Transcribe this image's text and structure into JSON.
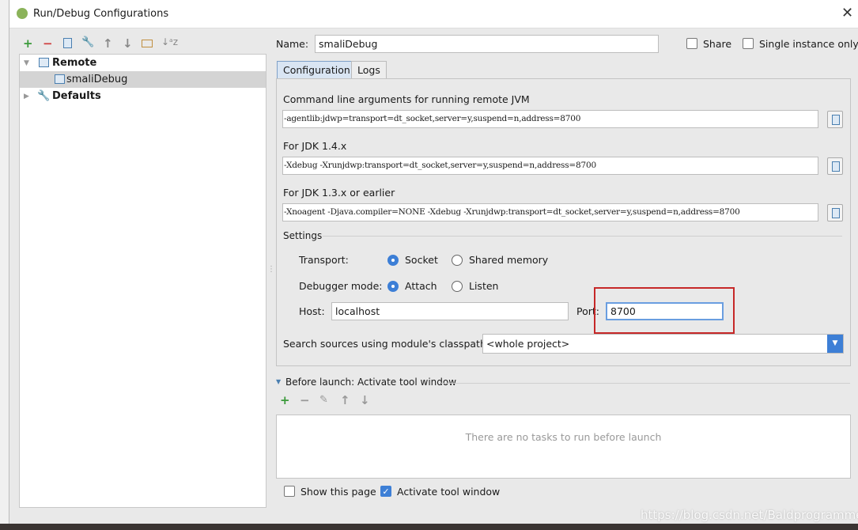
{
  "window": {
    "title": "Run/Debug Configurations",
    "close": "✕"
  },
  "toolbar": {
    "add": "+",
    "remove": "−",
    "copy": "copy-icon",
    "edit_defaults": "wrench-icon",
    "move_up": "↑",
    "move_down": "↓",
    "folder": "folder-icon",
    "sort": "↓ᵃz"
  },
  "tree": [
    {
      "label": "Remote",
      "expanded": true
    },
    {
      "label": "smaliDebug",
      "selected": true
    },
    {
      "label": "Defaults",
      "expanded": false
    }
  ],
  "name": {
    "label": "Name:",
    "value": "smaliDebug"
  },
  "share": {
    "label": "Share",
    "checked": false
  },
  "single_instance": {
    "label": "Single instance only",
    "checked": false
  },
  "tabs": [
    {
      "label": "Configuration",
      "active": true
    },
    {
      "label": "Logs",
      "active": false
    }
  ],
  "config": {
    "cmd_label": "Command line arguments for running remote JVM",
    "cmd_value": "-agentlib:jdwp=transport=dt_socket,server=y,suspend=n,address=8700",
    "jdk14_label": "For JDK 1.4.x",
    "jdk14_value": "-Xdebug -Xrunjdwp:transport=dt_socket,server=y,suspend=n,address=8700",
    "jdk13_label": "For JDK 1.3.x or earlier",
    "jdk13_value": "-Xnoagent -Djava.compiler=NONE -Xdebug -Xrunjdwp:transport=dt_socket,server=y,suspend=n,address=8700",
    "settings_label": "Settings",
    "transport_label": "Transport:",
    "transport_options": [
      "Socket",
      "Shared memory"
    ],
    "transport_selected": "Socket",
    "mode_label": "Debugger mode:",
    "mode_options": [
      "Attach",
      "Listen"
    ],
    "mode_selected": "Attach",
    "host_label": "Host:",
    "host_value": "localhost",
    "port_label": "Port:",
    "port_value": "8700",
    "classpath_label": "Search sources using module's classpath:",
    "classpath_value": "<whole project>"
  },
  "before_launch": {
    "label": "Before launch: Activate tool window",
    "empty": "There are no tasks to run before launch",
    "add": "+",
    "remove": "−",
    "edit": "✎",
    "up": "↑",
    "down": "↓"
  },
  "show_page": {
    "label": "Show this page",
    "checked": false
  },
  "activate_tool": {
    "label": "Activate tool window",
    "checked": true
  },
  "watermark": "https://blog.csdn.net/Baldprogrammer",
  "colors": {
    "highlight_box": "#c62828",
    "accent": "#3d7fd6"
  }
}
